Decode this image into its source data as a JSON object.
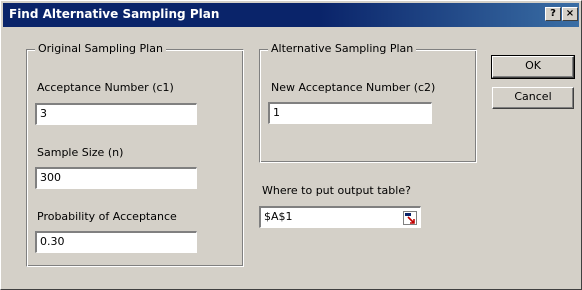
{
  "window": {
    "title": "Find Alternative Sampling Plan",
    "help_button": "?",
    "close_button": "×"
  },
  "original_plan": {
    "legend": "Original Sampling Plan",
    "acceptance_number_label": "Acceptance Number (c1)",
    "acceptance_number_value": "3",
    "sample_size_label": "Sample Size (n)",
    "sample_size_value": "300",
    "probability_label": "Probability of Acceptance",
    "probability_value": "0.30"
  },
  "alternative_plan": {
    "legend": "Alternative Sampling Plan",
    "new_acceptance_label": "New Acceptance Number (c2)",
    "new_acceptance_value": "1"
  },
  "output": {
    "label": "Where to put output table?",
    "value": "$A$1",
    "icon": "collapse-dialog-icon"
  },
  "buttons": {
    "ok": "OK",
    "cancel": "Cancel"
  },
  "colors": {
    "titlebar_start": "#0a246a",
    "titlebar_end": "#3a6ea5",
    "dialog_face": "#d4d0c8"
  }
}
